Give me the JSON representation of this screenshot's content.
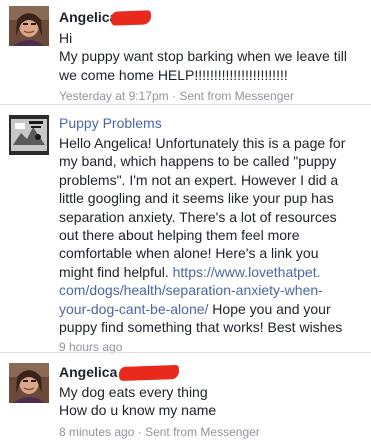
{
  "messages": [
    {
      "sender": "Angelica S",
      "lines": [
        "Hi",
        "My puppy want stop barking when we leave till",
        "we come home HELP!!!!!!!!!!!!!!!!!!!!!!!!"
      ],
      "timestamp": "Yesterday at 9:17pm",
      "separator": "·",
      "via": "Sent from Messenger"
    },
    {
      "sender": "Puppy Problems",
      "lines": [
        "Hello Angelica! Unfortunately this is a page for",
        "my band, which happens to be called \"puppy",
        "problems\". I'm not an expert. However I did a",
        "little googling and it seems like your pup has",
        "separation anxiety. There's a lot of resources",
        "out there about helping them feel more",
        "comfortable when alone! Here's a link you"
      ],
      "link_intro": "might find helpful. ",
      "link_line1": "https://www.lovethatpet.",
      "link_line2": "com/dogs/health/separation-anxiety-when-",
      "link_line3": "your-dog-cant-be-alone/",
      "after_link": " Hope you and your",
      "final_line": "puppy find something that works! Best wishes",
      "timestamp": "9 hours ago"
    },
    {
      "sender": "Angelica",
      "lines": [
        "My dog eats every thing",
        "How do u know my name"
      ],
      "timestamp": "8 minutes ago",
      "separator": "·",
      "via": "Sent from Messenger"
    }
  ],
  "colors": {
    "page_link": "#4b67a1",
    "meta_text": "#90949c",
    "redaction": "#e8291c",
    "divider": "#dddfe2"
  },
  "icons": {
    "avatar_user": "profile-photo",
    "avatar_page": "page-profile-photo"
  }
}
